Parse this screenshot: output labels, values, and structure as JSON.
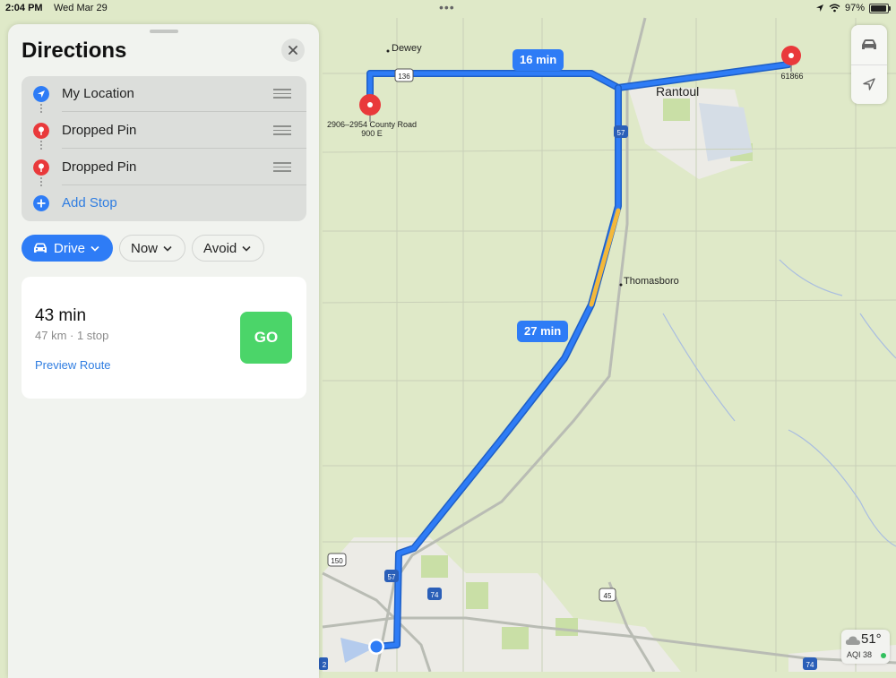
{
  "status_bar": {
    "time": "2:04 PM",
    "date": "Wed Mar 29",
    "battery": "97%",
    "battery_level": 0.97
  },
  "panel": {
    "title": "Directions"
  },
  "stops": [
    {
      "label": "My Location",
      "icon": "location-arrow-icon",
      "color": "#2e7cf6"
    },
    {
      "label": "Dropped Pin",
      "icon": "pin-icon",
      "color": "#e9393b"
    },
    {
      "label": "Dropped Pin",
      "icon": "pin-icon",
      "color": "#e9393b"
    },
    {
      "label": "Add Stop",
      "icon": "plus-icon",
      "color": "#2e7cf6"
    }
  ],
  "options": {
    "drive": "Drive",
    "now": "Now",
    "avoid": "Avoid"
  },
  "route_card": {
    "duration": "43 min",
    "details": "47 km · 1 stop",
    "preview": "Preview Route",
    "go": "GO"
  },
  "map": {
    "eta_1": "16 min",
    "eta_2": "27 min",
    "towns": {
      "dewey": "Dewey",
      "rantoul": "Rantoul",
      "thomasboro": "Thomasboro"
    },
    "pin_1_label": "2906–2954 County Road 900 E",
    "pin_2_label": "61866",
    "shields": {
      "us136": "136",
      "i57_a": "57",
      "i57_b": "57",
      "us150": "150",
      "i74": "74",
      "us45": "45",
      "i74_b": "74",
      "left_edge": "2"
    },
    "route_color": "#2e7cf6",
    "traffic_color": "#f3b83a"
  },
  "weather": {
    "temp": "51°",
    "aqi": "AQI 38"
  }
}
